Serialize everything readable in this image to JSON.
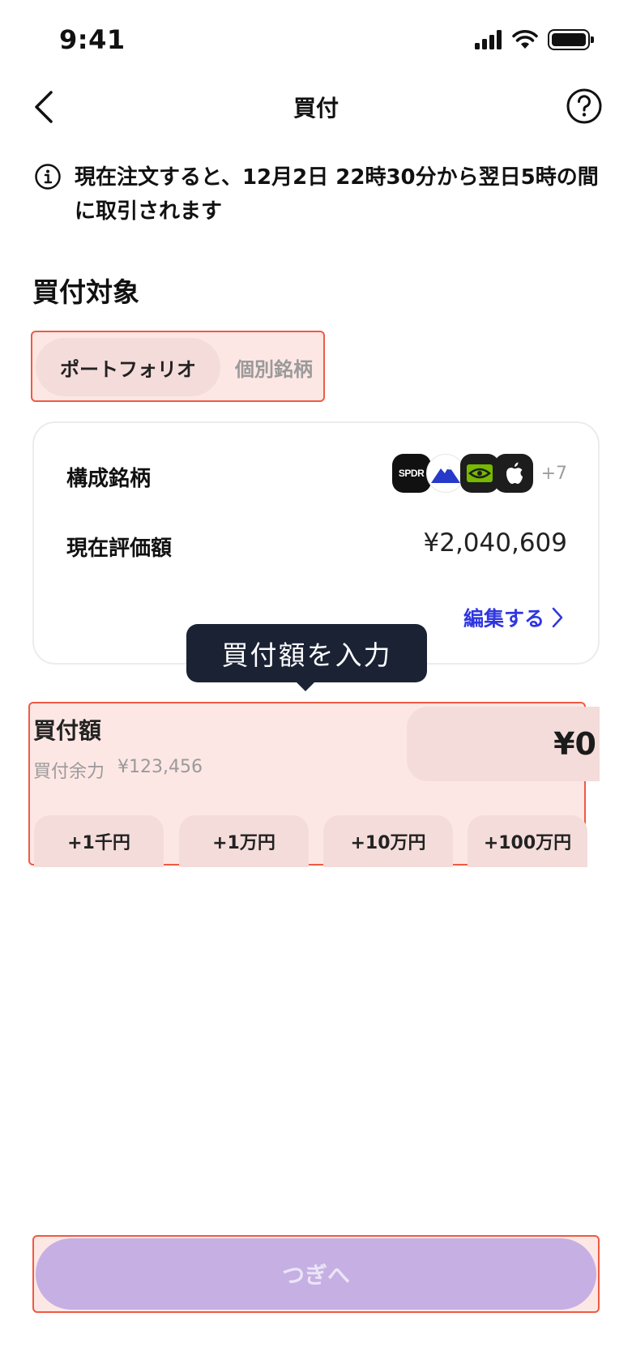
{
  "status_bar": {
    "time": "9:41"
  },
  "header": {
    "title": "買付"
  },
  "notice": {
    "text": "現在注文すると、12月2日 22時30分から翌日5時の間に取引されます"
  },
  "section": {
    "title": "買付対象"
  },
  "tabs": [
    {
      "label": "ポートフォリオ",
      "selected": true
    },
    {
      "label": "個別銘柄",
      "selected": false
    }
  ],
  "card": {
    "holdings_label": "構成銘柄",
    "logos": [
      {
        "icon": "spdr-logo",
        "text": "SPDR"
      },
      {
        "icon": "mountain-logo"
      },
      {
        "icon": "nvidia-logo"
      },
      {
        "icon": "apple-logo"
      }
    ],
    "more_count": "+7",
    "value_label": "現在評価額",
    "value": "¥2,040,609",
    "edit_label": "編集する"
  },
  "tooltip": {
    "text": "買付額を入力"
  },
  "purchase": {
    "label": "買付額",
    "buying_power_label": "買付余力",
    "buying_power_value": "¥123,456",
    "amount": "¥0",
    "quick_buttons": [
      "+1千円",
      "+1万円",
      "+10万円",
      "+100万円"
    ]
  },
  "next_button": {
    "label": "つぎへ"
  },
  "colors": {
    "accent_link": "#2f36e0",
    "primary_disabled": "#c5afe3",
    "highlight_border": "#ef5a43",
    "highlight_fill": "#fde7e4",
    "tooltip_bg": "#1a2234"
  }
}
